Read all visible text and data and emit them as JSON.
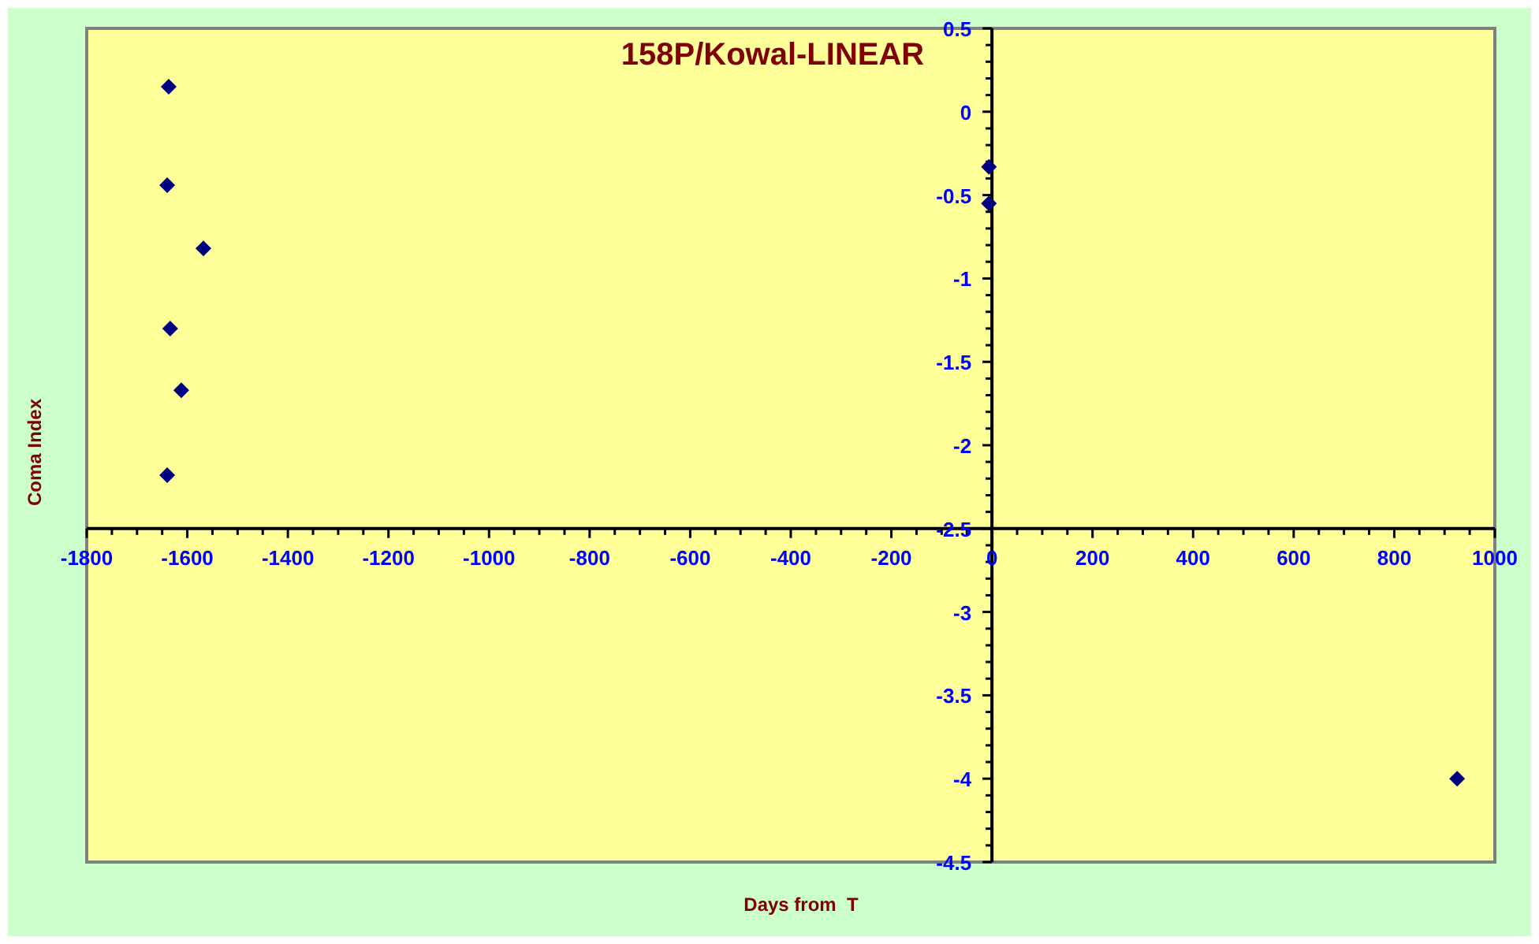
{
  "chart": {
    "chart_data": {
      "type": "scatter",
      "title": "158P/Kowal-LINEAR",
      "xlabel": "Days from  T",
      "ylabel": "Coma Index",
      "xlim": [
        -1800,
        1000
      ],
      "ylim": [
        -4.5,
        0.5
      ],
      "xticks": [
        -1800,
        -1600,
        -1400,
        -1200,
        -1000,
        -800,
        -600,
        -400,
        -200,
        0,
        200,
        400,
        600,
        800,
        1000
      ],
      "yticks": [
        0.5,
        0,
        -0.5,
        -1,
        -1.5,
        -2,
        -2.5,
        -3,
        -3.5,
        -4,
        -4.5
      ],
      "series": [
        {
          "color": "#000080",
          "x": [
            -1637,
            -1640,
            -1568,
            -1634,
            -1612,
            -1640,
            -6,
            -6,
            925
          ],
          "values": [
            0.15,
            -0.44,
            -0.82,
            -1.3,
            -1.67,
            -2.18,
            -0.33,
            -0.55,
            -4.0
          ]
        }
      ]
    }
  }
}
